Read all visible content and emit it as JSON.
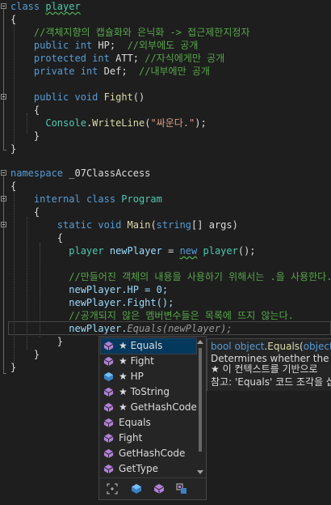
{
  "code": {
    "l01": {
      "kw": "class",
      "name": "player"
    },
    "l02": "{",
    "l03": "//객체지향의 캡슐화와 은닉화 -> 접근제한지정자",
    "l04": {
      "kw1": "public",
      "kw2": "int",
      "rest": "HP;",
      "cm": "//외부에도 공개"
    },
    "l05": {
      "kw1": "protected",
      "kw2": "int",
      "rest": "ATT;",
      "cm": "//자식에게만 공개"
    },
    "l06": {
      "kw1": "private",
      "kw2": "int",
      "rest": "Def;",
      "cm": "//내부에만 공개"
    },
    "l08": {
      "kw1": "public",
      "kw2": "void",
      "name": "Fight",
      "rest": "()"
    },
    "l09": "{",
    "l10": {
      "cls": "Console",
      "dot": ".",
      "mt": "WriteLine",
      "open": "(",
      "str": "\"싸운다.\"",
      "close": ");"
    },
    "l11": "}",
    "l12": "}",
    "l14": {
      "kw": "namespace",
      "name": "_07ClassAccess"
    },
    "l15": "{",
    "l16": {
      "kw1": "internal",
      "kw2": "class",
      "name": "Program"
    },
    "l17": "{",
    "l18": {
      "kw1": "static",
      "kw2": "void",
      "name": "Main",
      "open": "(",
      "kw3": "string",
      "rest": "[] args)"
    },
    "l19": "{",
    "l20": {
      "ty": "player",
      "var": "newPlayer",
      "eq": "=",
      "kw": "new",
      "ty2": "player",
      "rest": "();"
    },
    "l22": "//만들어진 객체의 내용을 사용하기 위해서는 .을 사용한다.",
    "l23": "newPlayer.HP = 0;",
    "l24": "newPlayer.Fight();",
    "l25": "//공개되지 않은 멤버변수들은 목록에 뜨지 않는다.",
    "l26": {
      "obj": "newPlayer.",
      "ghost": "Equals(newPlayer);"
    },
    "l27": "}",
    "l28": "}",
    "l29": "}"
  },
  "completion": {
    "items": [
      {
        "label": "★ Equals",
        "icon": "method-icon",
        "selected": true
      },
      {
        "label": "★ Fight",
        "icon": "method-icon",
        "selected": false
      },
      {
        "label": "★ HP",
        "icon": "field-icon",
        "selected": false
      },
      {
        "label": "★ ToString",
        "icon": "method-icon",
        "selected": false
      },
      {
        "label": "★ GetHashCode",
        "icon": "method-icon",
        "selected": false
      },
      {
        "label": "Equals",
        "icon": "method-icon",
        "selected": false
      },
      {
        "label": "Fight",
        "icon": "method-icon",
        "selected": false
      },
      {
        "label": "GetHashCode",
        "icon": "method-icon",
        "selected": false
      },
      {
        "label": "GetType",
        "icon": "method-icon",
        "selected": false
      }
    ],
    "filters": [
      "snippet-filter-icon",
      "field-filter-icon",
      "method-filter-icon",
      "extension-filter-icon"
    ]
  },
  "tooltip": {
    "sig_type": "bool",
    "sig_obj": "object",
    "sig_dot": ".",
    "sig_method": "Equals",
    "sig_open": "(",
    "sig_param": "object",
    "sig_rest": "? o",
    "description": "Determines whether the spe",
    "star_note": "★  이 컨텍스트를 기반으로",
    "ref_note": "참고: 'Equals' 코드 조각을 삽"
  },
  "colors": {
    "background": "#1e1e1e",
    "keyword": "#569cd6",
    "type": "#4ec9b0",
    "comment": "#57a64a",
    "method": "#dcdcaa",
    "string": "#d69d85",
    "variable": "#9cdcfe"
  }
}
